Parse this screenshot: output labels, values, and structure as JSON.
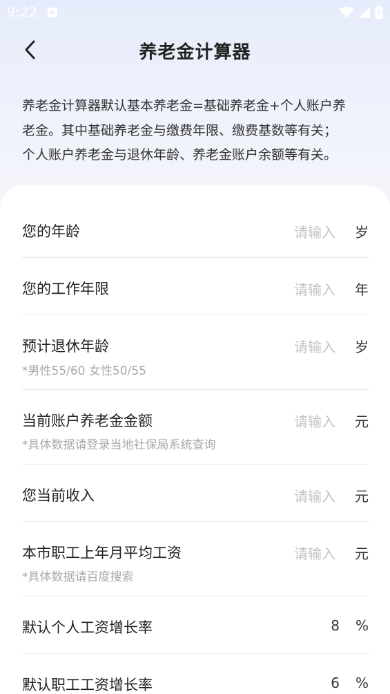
{
  "status": {
    "time": "9:22",
    "badge": "A"
  },
  "header": {
    "title": "养老金计算器"
  },
  "intro": {
    "line1": "养老金计算器默认基本养老金=基础养老金+个人账户养",
    "line2": "老金。其中基础养老金与缴费年限、缴费基数等有关；",
    "line3": "个人账户养老金与退休年龄、养老金账户余额等有关。"
  },
  "form": {
    "placeholder": "请输入",
    "rows": [
      {
        "label": "您的年龄",
        "hint": "",
        "value": "",
        "unit": "岁"
      },
      {
        "label": "您的工作年限",
        "hint": "",
        "value": "",
        "unit": "年"
      },
      {
        "label": "预计退休年龄",
        "hint": "*男性55/60  女性50/55",
        "value": "",
        "unit": "岁"
      },
      {
        "label": "当前账户养老金金额",
        "hint": "*具体数据请登录当地社保局系统查询",
        "value": "",
        "unit": "元"
      },
      {
        "label": "您当前收入",
        "hint": "",
        "value": "",
        "unit": "元"
      },
      {
        "label": "本市职工上年月平均工资",
        "hint": "*具体数据请百度搜索",
        "value": "",
        "unit": "元"
      },
      {
        "label": "默认个人工资增长率",
        "hint": "",
        "value": "8",
        "unit": "%"
      },
      {
        "label": "默认职工工资增长率",
        "hint": "",
        "value": "6",
        "unit": "%"
      }
    ]
  }
}
